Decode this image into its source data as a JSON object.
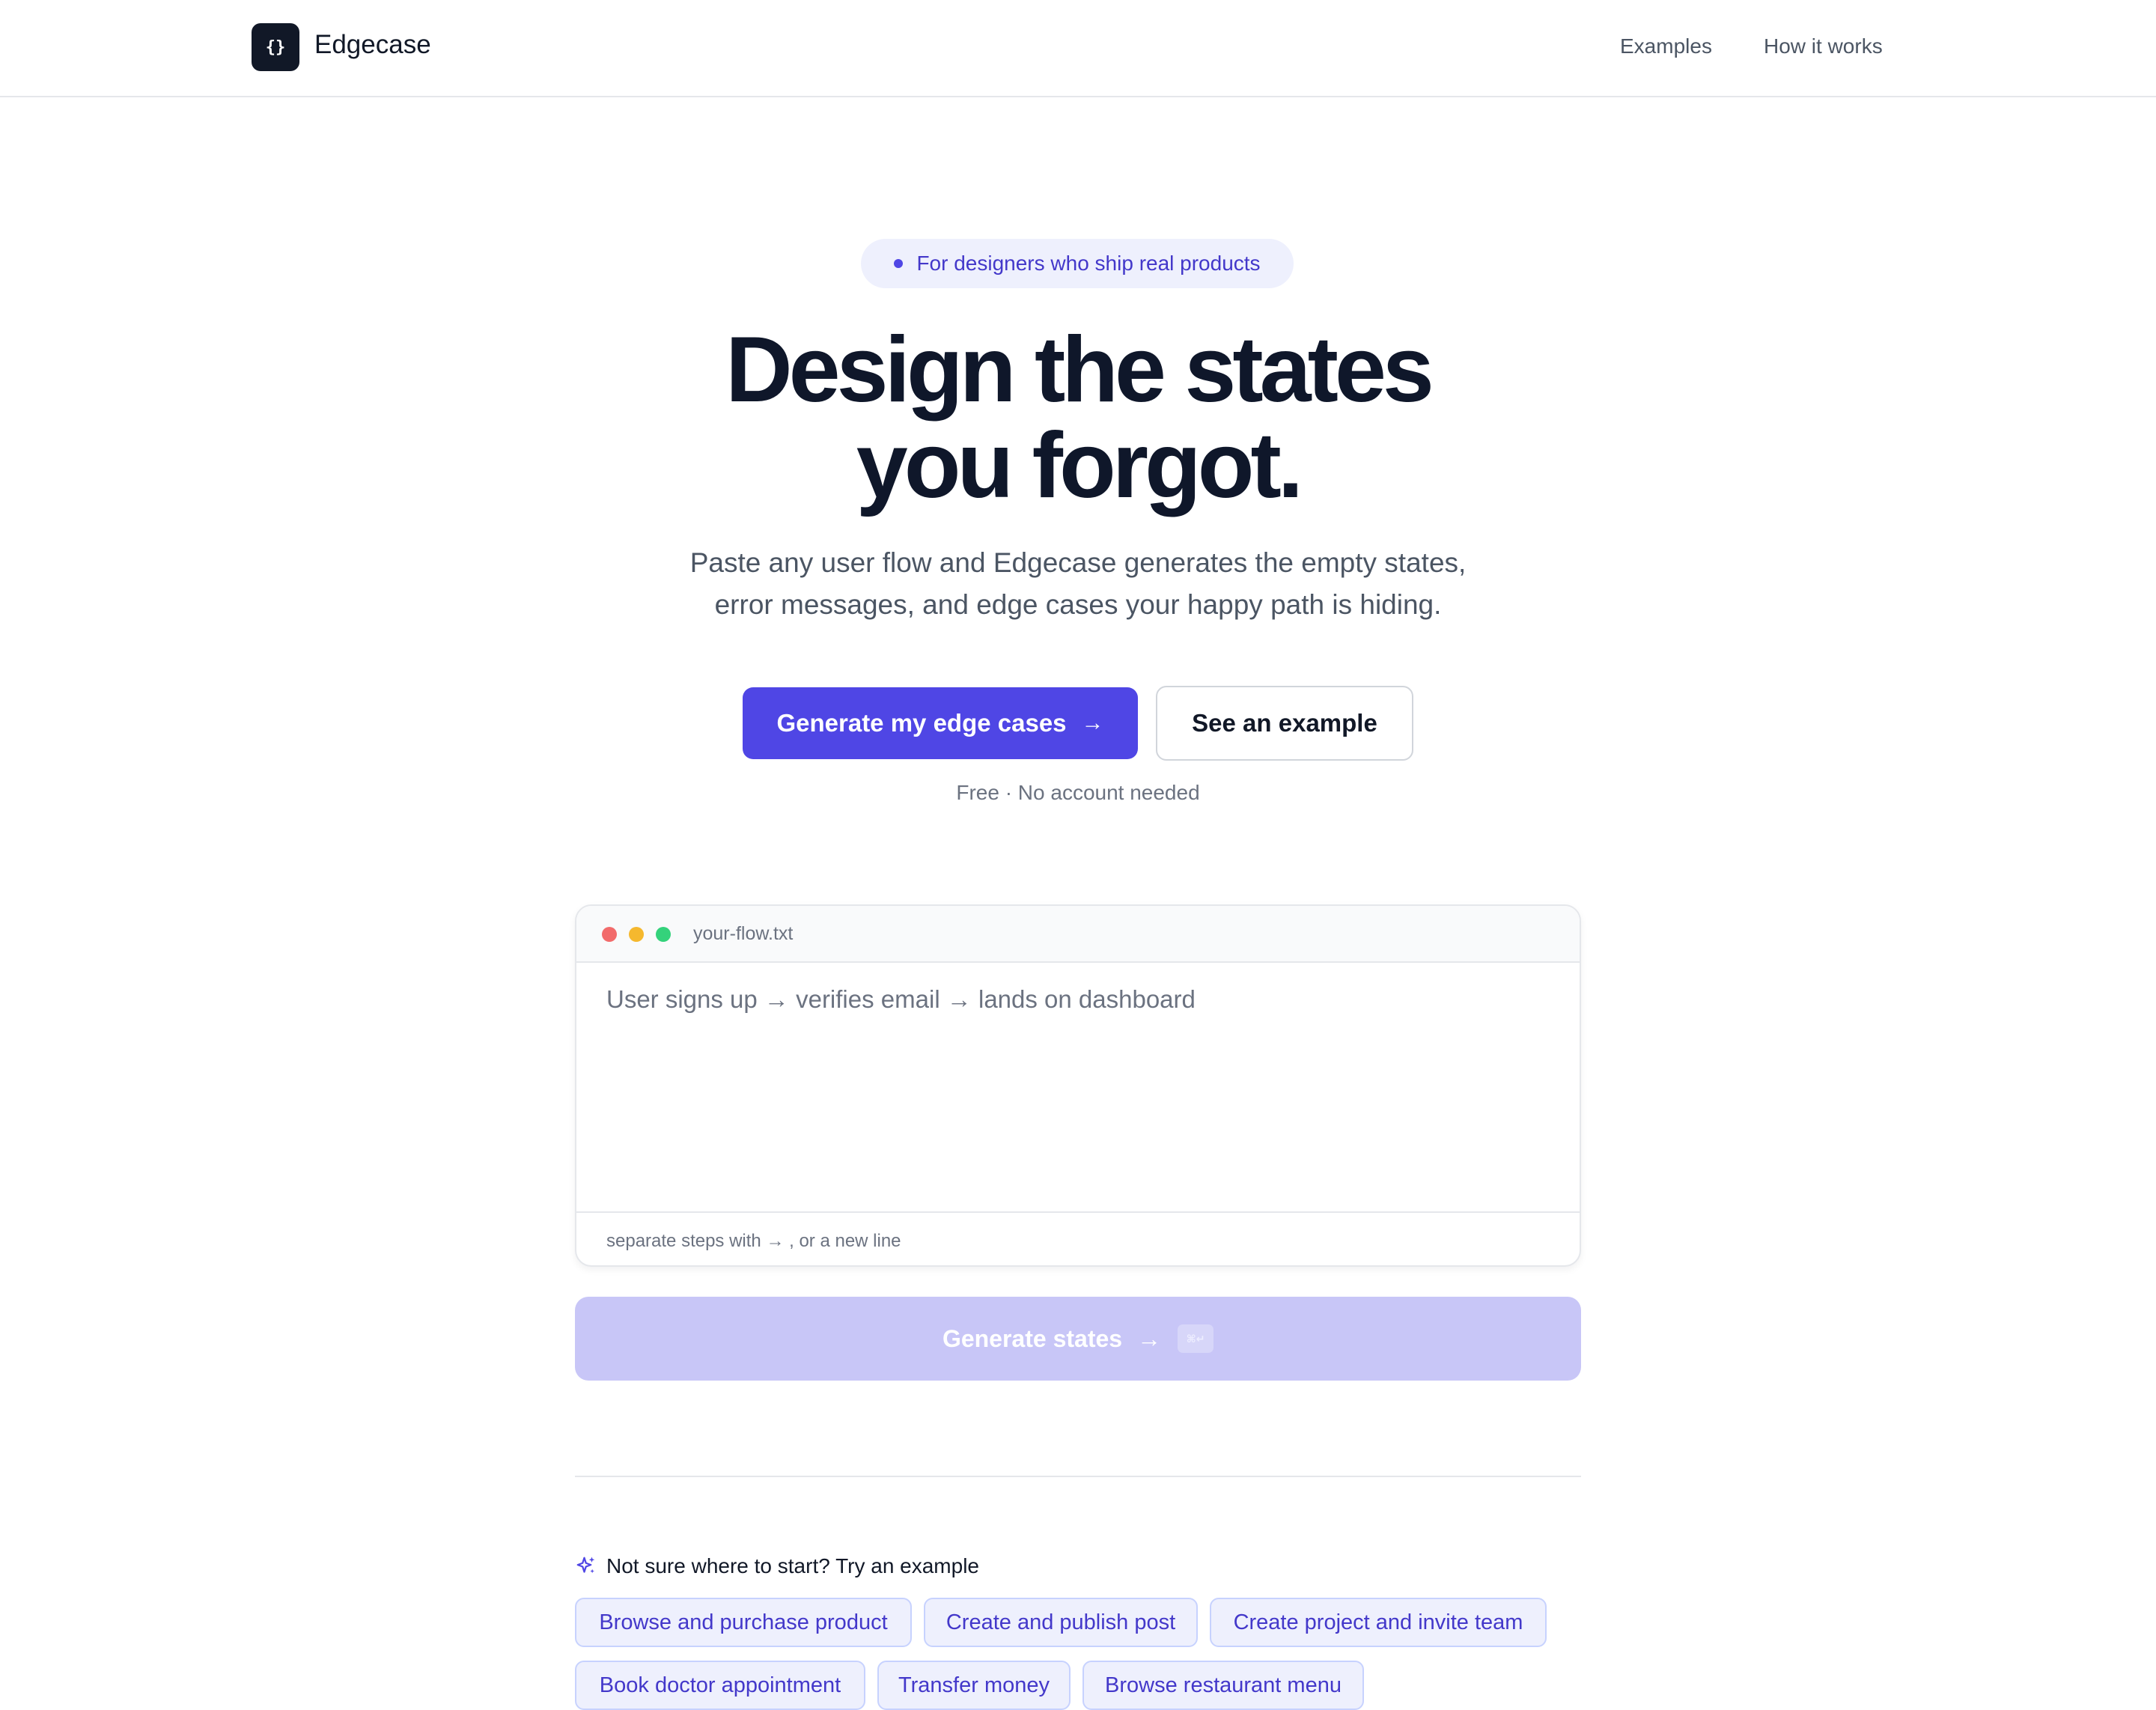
{
  "header": {
    "logo_glyph": "{}",
    "brand": "Edgecase",
    "nav": [
      "Examples",
      "How it works"
    ]
  },
  "hero": {
    "badge": "For designers who ship real products",
    "headline_line1": "Design the states",
    "headline_line2": "you forgot.",
    "subtitle_line1": "Paste any user flow and Edgecase generates the empty states,",
    "subtitle_line2": "error messages, and edge cases your happy path is hiding.",
    "primary_cta": "Generate my edge cases",
    "secondary_cta": "See an example",
    "note": "Free · No account needed"
  },
  "editor": {
    "file_name": "your-flow.txt",
    "placeholder": "User signs up → verifies email → lands on dashboard",
    "value": "",
    "hint": "separate steps with → , or a new line"
  },
  "generate": {
    "label": "Generate states",
    "shortcut": "⌘↵"
  },
  "examples": {
    "heading": "Not sure where to start? Try an example",
    "items": [
      "Browse and purchase product",
      "Create and publish post",
      "Create project and invite team",
      "Book doctor appointment",
      "Transfer money",
      "Browse restaurant menu"
    ]
  },
  "colors": {
    "accent": "#4f46e5",
    "accent_disabled": "#c8c6f7",
    "chip_bg": "#eef0fd",
    "chip_text": "#4338ca",
    "dot_red": "#f26b6b",
    "dot_yellow": "#f5b82e",
    "dot_green": "#34d27b"
  },
  "icons": {
    "arrow": "arrow-right-icon",
    "sparkle": "sparkle-icon"
  }
}
